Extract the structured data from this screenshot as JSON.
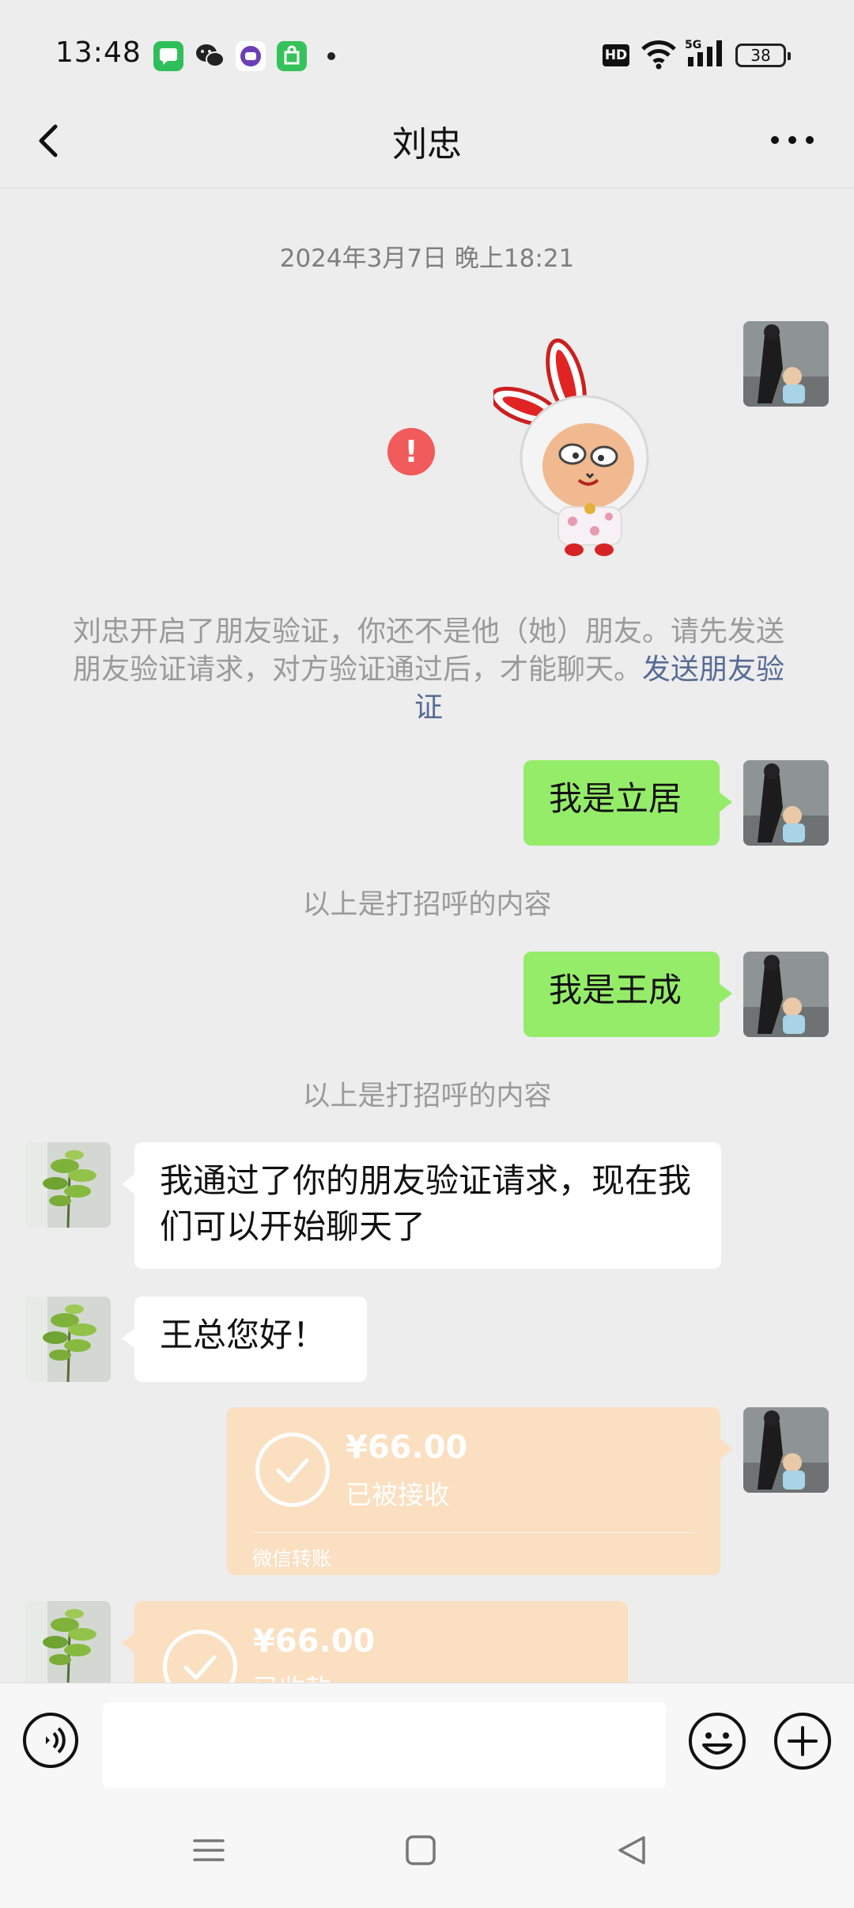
{
  "status_bar": {
    "time": "13:48",
    "hd": "HD",
    "network": "5G",
    "battery": "38",
    "app_icons": [
      "messages-icon",
      "wechat-icon",
      "purple-app-icon",
      "store-icon"
    ]
  },
  "header": {
    "title": "刘忠",
    "back_icon": "chevron-left-icon",
    "more_icon": "more-dots-icon"
  },
  "chat": {
    "timestamp": "2024年3月7日 晚上18:21",
    "sticker": "bunny-sticker",
    "send_failed_mark": "!",
    "system_notice": "刘忠开启了朋友验证，你还不是他（她）朋友。请先发送朋友验证请求，对方验证通过后，才能聊天。",
    "system_notice_link": "发送朋友验证",
    "messages": [
      {
        "from": "me",
        "text": "我是立居"
      },
      {
        "from": "system",
        "text": "以上是打招呼的内容"
      },
      {
        "from": "me",
        "text": "我是王成"
      },
      {
        "from": "system",
        "text": "以上是打招呼的内容"
      },
      {
        "from": "him",
        "text": "我通过了你的朋友验证请求，现在我们可以开始聊天了"
      },
      {
        "from": "him",
        "text": "王总您好！"
      }
    ],
    "transfers": [
      {
        "from": "me",
        "amount": "¥66.00",
        "status": "已被接收",
        "label": "微信转账"
      },
      {
        "from": "him",
        "amount": "¥66.00",
        "status": "已收款"
      }
    ]
  },
  "colors": {
    "my_bubble": "#95ec69",
    "his_bubble": "#ffffff",
    "transfer": "#fbdfc1",
    "link": "#576b95",
    "error": "#f15b5b"
  },
  "input_bar": {
    "voice_icon": "voice-icon",
    "emoji_icon": "emoji-icon",
    "plus_icon": "plus-icon"
  },
  "system_nav": [
    "menu-icon",
    "home-icon",
    "back-icon"
  ]
}
